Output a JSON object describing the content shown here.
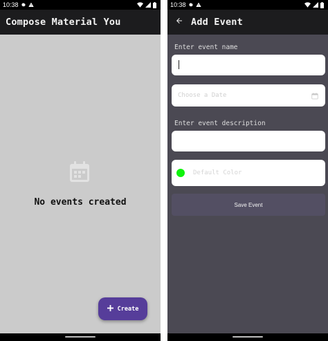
{
  "status_bar": {
    "time": "10:38"
  },
  "home": {
    "app_title": "Compose Material You",
    "empty_message": "No events created",
    "fab_label": "Create"
  },
  "add_event": {
    "title": "Add Event",
    "name_label": "Enter event name",
    "name_value": "",
    "date_placeholder": "Choose a Date",
    "description_label": "Enter event description",
    "description_value": "",
    "color_placeholder": "Default Color",
    "save_label": "Save Event",
    "default_color": "#0ff30c"
  },
  "colors": {
    "app_bar": "#1c1c1e",
    "home_background": "#cbcbcb",
    "form_background": "#4b4953",
    "fab": "#563d9a",
    "save_button": "#534f63"
  }
}
